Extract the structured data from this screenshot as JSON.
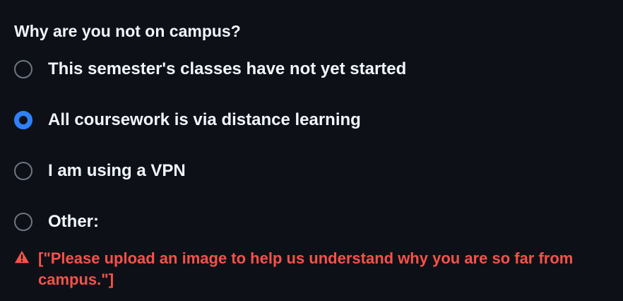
{
  "question": {
    "label": "Why are you not on campus?",
    "selected": "All coursework is via distance learning",
    "options": [
      {
        "label": "This semester's classes have not yet started",
        "checked": false
      },
      {
        "label": "All coursework is via distance learning",
        "checked": true
      },
      {
        "label": "I am using a VPN",
        "checked": false
      },
      {
        "label": "Other:",
        "checked": false
      }
    ]
  },
  "error": {
    "icon": "warning-icon",
    "message": "[\"Please upload an image to help us understand why you are so far from campus.\"]"
  },
  "colors": {
    "background": "#0d1117",
    "text": "#f0f6fc",
    "accent": "#2f81f7",
    "radio_border": "#6e7681",
    "error": "#f85149"
  }
}
